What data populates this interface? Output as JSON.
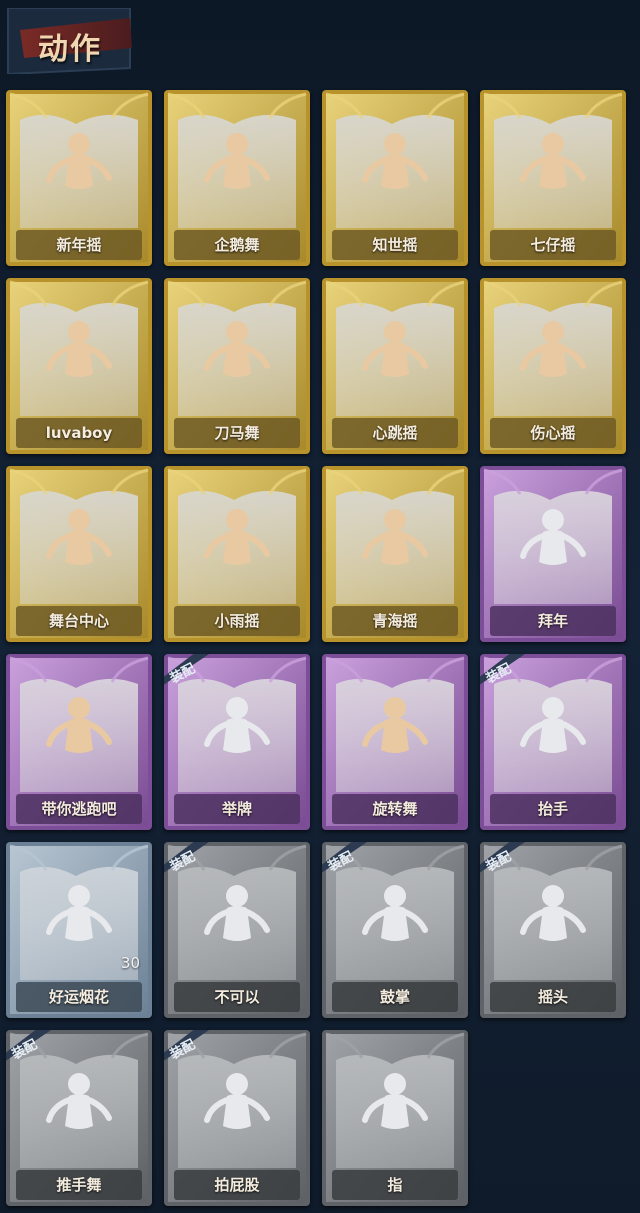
{
  "page": {
    "title": "动作"
  },
  "colors": {
    "gold": "#c9a531",
    "purple": "#8a5ea8",
    "bluegray": "#7f93a6",
    "gray": "#6d7176",
    "silhouette": "#e8c9a2"
  },
  "equip_label": "装配",
  "cards": [
    {
      "label": "新年摇",
      "tier": "gold",
      "icon": "dancer-silhouette-icon",
      "equipped": false
    },
    {
      "label": "企鹅舞",
      "tier": "gold",
      "icon": "dancer-silhouette-icon",
      "equipped": false
    },
    {
      "label": "知世摇",
      "tier": "gold",
      "icon": "dancer-silhouette-icon",
      "equipped": false
    },
    {
      "label": "七仔摇",
      "tier": "gold",
      "icon": "dancer-silhouette-icon",
      "equipped": false
    },
    {
      "label": "luvaboy",
      "tier": "gold",
      "icon": "dancer-silhouette-icon",
      "equipped": false
    },
    {
      "label": "刀马舞",
      "tier": "gold",
      "icon": "dancer-silhouette-icon",
      "equipped": false
    },
    {
      "label": "心跳摇",
      "tier": "gold",
      "icon": "dancer-silhouette-icon",
      "equipped": false
    },
    {
      "label": "伤心摇",
      "tier": "gold",
      "icon": "heart-hands-silhouette-icon",
      "equipped": false
    },
    {
      "label": "舞台中心",
      "tier": "gold",
      "icon": "dancer-silhouette-icon",
      "equipped": false
    },
    {
      "label": "小雨摇",
      "tier": "gold",
      "icon": "dancer-silhouette-icon",
      "equipped": false
    },
    {
      "label": "青海摇",
      "tier": "gold",
      "icon": "dancer-silhouette-icon",
      "equipped": false
    },
    {
      "label": "拜年",
      "tier": "purple",
      "icon": "bow-silhouette-icon",
      "equipped": false
    },
    {
      "label": "带你逃跑吧",
      "tier": "purple",
      "icon": "dancer-silhouette-icon",
      "equipped": false
    },
    {
      "label": "举牌",
      "tier": "purple",
      "icon": "sign-holder-icon",
      "equipped": true
    },
    {
      "label": "旋转舞",
      "tier": "purple",
      "icon": "spin-dance-icon",
      "equipped": false
    },
    {
      "label": "抬手",
      "tier": "purple",
      "icon": "raise-hand-icon",
      "equipped": true
    },
    {
      "label": "好运烟花",
      "tier": "bluegray",
      "icon": "firework-icon",
      "equipped": false,
      "count": "30"
    },
    {
      "label": "不可以",
      "tier": "gray",
      "icon": "finger-wag-icon",
      "equipped": true
    },
    {
      "label": "鼓掌",
      "tier": "gray",
      "icon": "clap-icon",
      "equipped": true
    },
    {
      "label": "摇头",
      "tier": "gray",
      "icon": "head-shake-icon",
      "equipped": true
    },
    {
      "label": "推手舞",
      "tier": "gray",
      "icon": "push-dance-icon",
      "equipped": true
    },
    {
      "label": "拍屁股",
      "tier": "gray",
      "icon": "butt-pat-icon",
      "equipped": true
    },
    {
      "label": "指",
      "tier": "gray",
      "icon": "point-icon",
      "equipped": false
    }
  ]
}
